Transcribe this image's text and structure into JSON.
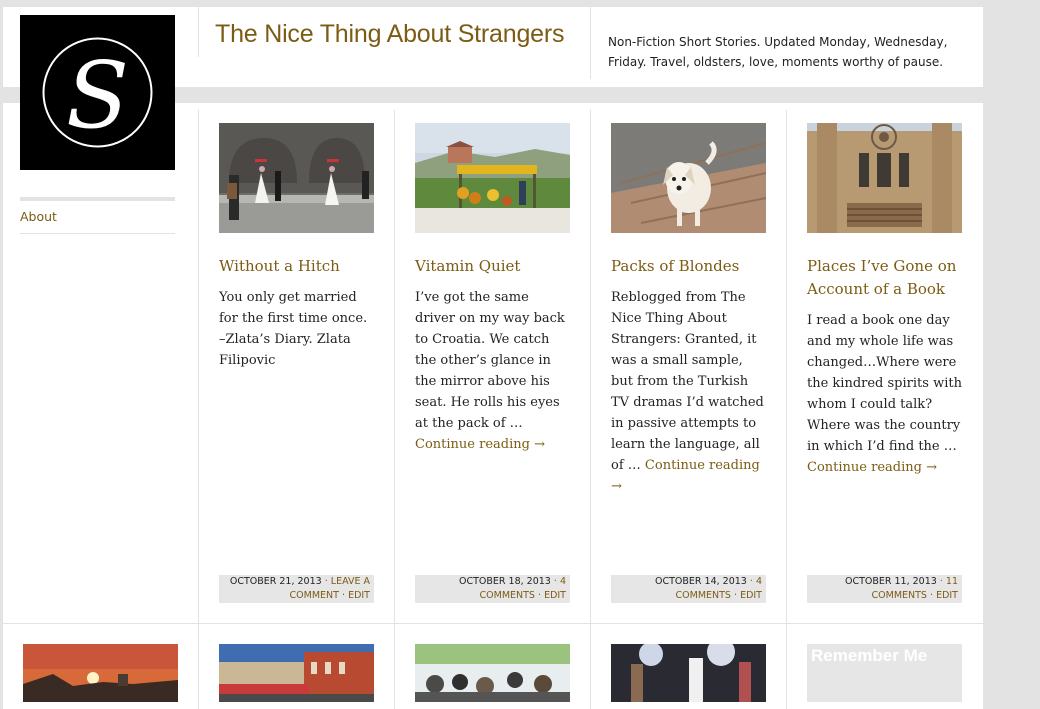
{
  "site": {
    "title": "The Nice Thing About Strangers",
    "tagline": "Non-Fiction Short Stories. Updated Monday, Wednesday, Friday. Travel, oldsters, love, moments worthy of pause.",
    "logo_letter": "S"
  },
  "menu": {
    "about": "About"
  },
  "posts": [
    {
      "title": "Without a Hitch",
      "excerpt": "You only get married for the first time once. –Zlata’s Diary. Zlata Filipovic",
      "more": "",
      "date": "OCTOBER 21, 2013",
      "comments": "LEAVE A COMMENT",
      "edit": "EDIT",
      "thumb_icon": "wedding-street-photo"
    },
    {
      "title": "Vitamin Quiet",
      "excerpt": "I’ve got the same driver on my way back to Croatia. We catch the other’s glance in the mirror above his seat. He rolls his eyes at the pack of …",
      "more": "Continue reading →",
      "date": "OCTOBER 18, 2013",
      "comments": "4 COMMENTS",
      "edit": "EDIT",
      "thumb_icon": "roadside-stand-photo"
    },
    {
      "title": "Packs of Blondes",
      "excerpt": "Reblogged from The Nice Thing About Strangers: Granted, it was a small sample, but from the Turkish TV dramas I’d watched in passive attempts to learn the language, all of …",
      "more": "Continue reading →",
      "date": "OCTOBER 14, 2013",
      "comments": "4 COMMENTS",
      "edit": "EDIT",
      "thumb_icon": "white-dog-photo"
    },
    {
      "title": "Places I’ve Gone on Account of a Book",
      "excerpt": "I read a book one day and my whole life was changed…Where were the kindred spirits with whom I could talk? Where was the country in which I’d find the …",
      "more": "Continue reading →",
      "date": "OCTOBER 11, 2013",
      "comments": "11 COMMENTS",
      "edit": "EDIT",
      "thumb_icon": "building-facade-photo"
    }
  ],
  "row2": {
    "remember": "Remember Me"
  },
  "colors": {
    "accent": "#7c5c14",
    "meta_bg": "#e6e6e6",
    "page_bg": "#e3e3e3"
  }
}
